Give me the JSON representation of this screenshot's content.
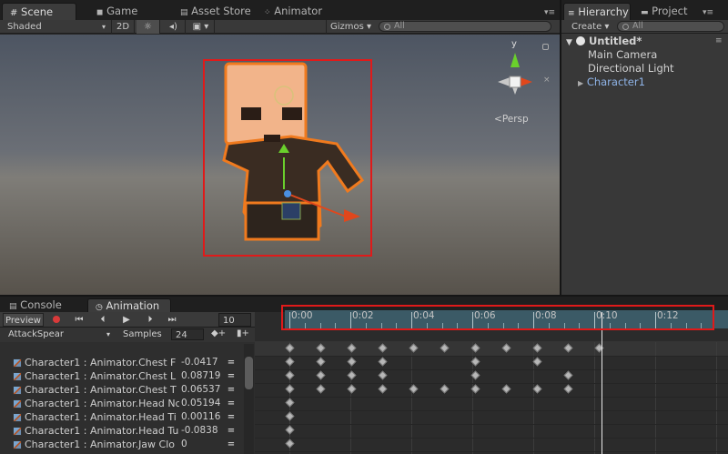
{
  "scene_tabs": {
    "scene": "Scene",
    "game": "Game",
    "asset_store": "Asset Store",
    "animator": "Animator"
  },
  "scene_toolbar": {
    "shading": "Shaded",
    "mode_2d": "2D",
    "gizmos": "Gizmos",
    "search_placeholder": "All"
  },
  "gizmo": {
    "y_axis": "y",
    "persp": "Persp"
  },
  "hierarchy": {
    "tab": "Hierarchy",
    "project_tab": "Project",
    "create": "Create",
    "search_placeholder": "All",
    "scene_name": "Untitled*",
    "items": [
      {
        "label": "Main Camera"
      },
      {
        "label": "Directional Light"
      },
      {
        "label": "Character1"
      }
    ]
  },
  "bottom_tabs": {
    "console": "Console",
    "animation": "Animation"
  },
  "animation": {
    "preview": "Preview",
    "frame": "10",
    "clip": "AttackSpear",
    "samples_label": "Samples",
    "samples": "24",
    "timeline": [
      "0:00",
      "0:02",
      "0:04",
      "0:06",
      "0:08",
      "0:10",
      "0:12"
    ],
    "properties": [
      {
        "name": "Character1 : Animator.Chest F",
        "value": "-0.0417"
      },
      {
        "name": "Character1 : Animator.Chest L",
        "value": "0.08719"
      },
      {
        "name": "Character1 : Animator.Chest T",
        "value": "0.06537"
      },
      {
        "name": "Character1 : Animator.Head Nc",
        "value": "0.05194"
      },
      {
        "name": "Character1 : Animator.Head Ti",
        "value": "0.00116"
      },
      {
        "name": "Character1 : Animator.Head Tu",
        "value": "-0.0838"
      },
      {
        "name": "Character1 : Animator.Jaw Clo",
        "value": "0"
      }
    ],
    "remove_glyph": "="
  },
  "colors": {
    "highlight_box": "#e01a1a",
    "selection_outline": "#f07a1e",
    "hierarchy_selected": "#8fb4e8"
  }
}
